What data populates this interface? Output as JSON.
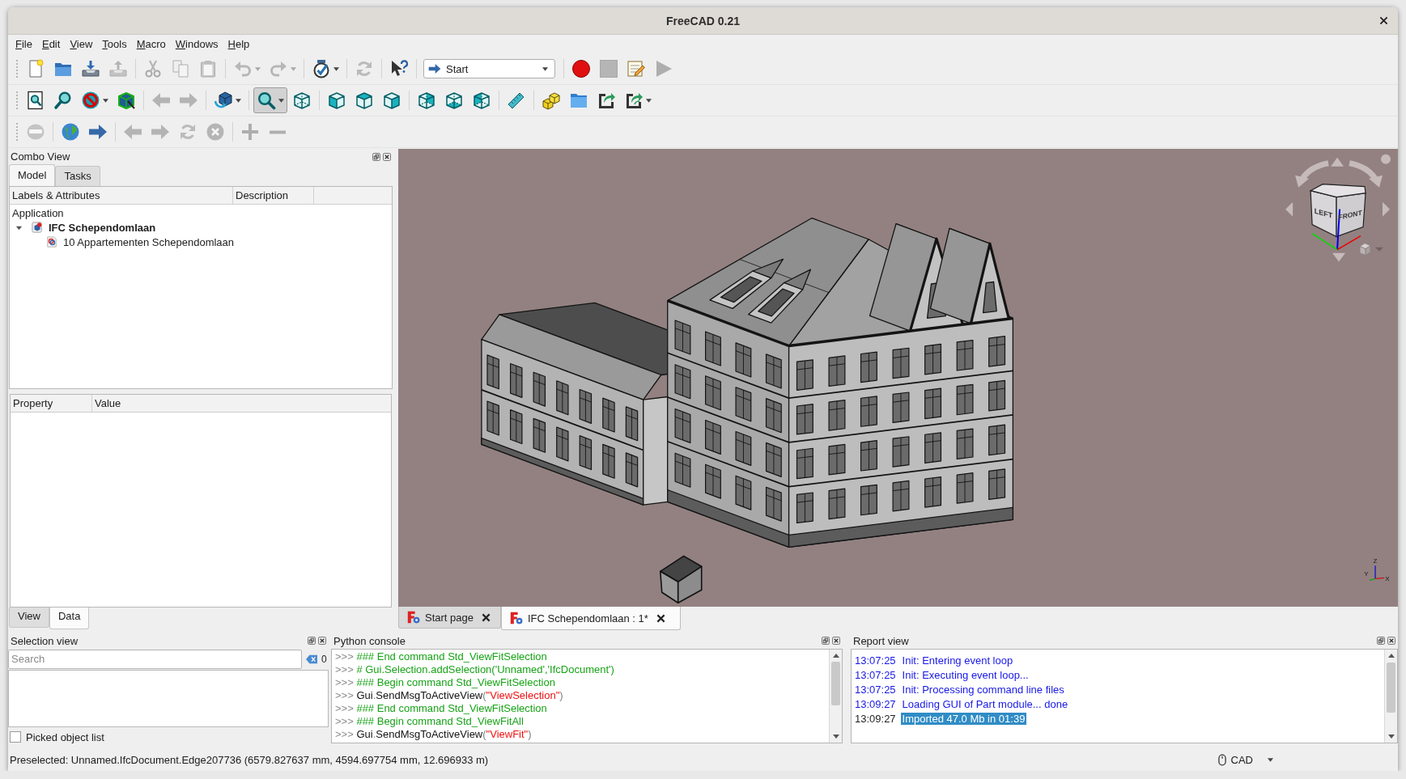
{
  "window": {
    "title": "FreeCAD 0.21"
  },
  "menu": [
    "File",
    "Edit",
    "View",
    "Tools",
    "Macro",
    "Windows",
    "Help"
  ],
  "toolbars": [
    {
      "groups": [
        [
          {
            "kind": "button",
            "disabled": false,
            "pressed": false,
            "menu": false
          },
          {
            "kind": "button",
            "disabled": false,
            "pressed": false,
            "menu": false
          },
          {
            "kind": "button",
            "disabled": false,
            "pressed": false,
            "menu": false
          },
          {
            "kind": "button",
            "disabled": true,
            "pressed": false,
            "menu": false
          }
        ],
        [
          {
            "kind": "button",
            "disabled": true,
            "pressed": false,
            "menu": false
          },
          {
            "kind": "button",
            "disabled": true,
            "pressed": false,
            "menu": false
          },
          {
            "kind": "button",
            "disabled": true,
            "pressed": false,
            "menu": false
          }
        ],
        [
          {
            "kind": "button",
            "disabled": true,
            "pressed": false,
            "menu": true
          },
          {
            "kind": "button",
            "disabled": true,
            "pressed": false,
            "menu": true
          }
        ],
        [
          {
            "kind": "button",
            "disabled": false,
            "pressed": false,
            "menu": true
          }
        ],
        [
          {
            "kind": "button",
            "disabled": true,
            "pressed": false,
            "menu": false
          }
        ],
        [
          {
            "kind": "button",
            "disabled": false,
            "pressed": false,
            "menu": false
          }
        ],
        [
          {
            "kind": "combo",
            "value": "Start"
          }
        ],
        [
          {
            "kind": "button",
            "disabled": false,
            "pressed": false,
            "menu": false
          },
          {
            "kind": "button",
            "disabled": true,
            "pressed": false,
            "menu": false
          },
          {
            "kind": "button",
            "disabled": false,
            "pressed": false,
            "menu": false
          },
          {
            "kind": "button",
            "disabled": true,
            "pressed": false,
            "menu": false
          }
        ]
      ]
    },
    {
      "groups": [
        [
          {
            "kind": "button",
            "disabled": false,
            "pressed": false,
            "menu": false
          },
          {
            "kind": "button",
            "disabled": false,
            "pressed": false,
            "menu": false
          },
          {
            "kind": "button",
            "disabled": false,
            "pressed": false,
            "menu": true
          },
          {
            "kind": "button",
            "disabled": false,
            "pressed": false,
            "menu": false
          }
        ],
        [
          {
            "kind": "button",
            "disabled": true,
            "pressed": false,
            "menu": false
          },
          {
            "kind": "button",
            "disabled": true,
            "pressed": false,
            "menu": false
          }
        ],
        [
          {
            "kind": "button",
            "disabled": false,
            "pressed": false,
            "menu": true
          }
        ],
        [
          {
            "kind": "button",
            "disabled": false,
            "pressed": true,
            "menu": true
          },
          {
            "kind": "button",
            "disabled": false,
            "pressed": false,
            "menu": false
          }
        ],
        [
          {
            "kind": "button",
            "disabled": false,
            "pressed": false,
            "menu": false
          },
          {
            "kind": "button",
            "disabled": false,
            "pressed": false,
            "menu": false
          },
          {
            "kind": "button",
            "disabled": false,
            "pressed": false,
            "menu": false
          }
        ],
        [
          {
            "kind": "button",
            "disabled": false,
            "pressed": false,
            "menu": false
          },
          {
            "kind": "button",
            "disabled": false,
            "pressed": false,
            "menu": false
          },
          {
            "kind": "button",
            "disabled": false,
            "pressed": false,
            "menu": false
          }
        ],
        [
          {
            "kind": "button",
            "disabled": false,
            "pressed": false,
            "menu": false
          }
        ],
        [
          {
            "kind": "button",
            "disabled": false,
            "pressed": false,
            "menu": false
          },
          {
            "kind": "button",
            "disabled": false,
            "pressed": false,
            "menu": false
          },
          {
            "kind": "button",
            "disabled": false,
            "pressed": false,
            "menu": false
          },
          {
            "kind": "button",
            "disabled": false,
            "pressed": false,
            "menu": true
          }
        ]
      ]
    },
    {
      "groups": [
        [
          {
            "kind": "button",
            "disabled": true,
            "pressed": false,
            "menu": false
          }
        ],
        [
          {
            "kind": "button",
            "disabled": false,
            "pressed": false,
            "menu": false
          },
          {
            "kind": "button",
            "disabled": false,
            "pressed": false,
            "menu": false
          }
        ],
        [
          {
            "kind": "button",
            "disabled": true,
            "pressed": false,
            "menu": false
          },
          {
            "kind": "button",
            "disabled": true,
            "pressed": false,
            "menu": false
          },
          {
            "kind": "button",
            "disabled": true,
            "pressed": false,
            "menu": false
          },
          {
            "kind": "button",
            "disabled": true,
            "pressed": false,
            "menu": false
          }
        ],
        [
          {
            "kind": "button",
            "disabled": true,
            "pressed": false,
            "menu": false
          },
          {
            "kind": "button",
            "disabled": true,
            "pressed": false,
            "menu": false
          }
        ]
      ]
    }
  ],
  "combo_view": {
    "title": "Combo View",
    "tabs": [
      {
        "label": "Model",
        "selected": true
      },
      {
        "label": "Tasks",
        "selected": false
      }
    ],
    "tree": {
      "columns": [
        "Labels & Attributes",
        "Description"
      ],
      "root": "Application",
      "documents": [
        {
          "label": "IFC Schependomlaan",
          "active": true,
          "expanded": true,
          "children": [
            {
              "label": "10 Appartementen Schependomlaan"
            }
          ]
        }
      ]
    },
    "property_view": {
      "columns": [
        "Property",
        "Value"
      ],
      "tabs": [
        {
          "label": "View",
          "selected": false
        },
        {
          "label": "Data",
          "selected": true
        }
      ]
    }
  },
  "viewport": {
    "nav_cube": {
      "faces": [
        "LEFT",
        "FRONT"
      ]
    },
    "axis_labels": [
      "Z",
      "Y",
      "X"
    ],
    "tabs": [
      {
        "label": "Start page",
        "selected": false
      },
      {
        "label": "IFC Schependomlaan : 1*",
        "selected": true
      }
    ]
  },
  "selection_view": {
    "title": "Selection view",
    "search": {
      "placeholder": "Search"
    },
    "count": "0",
    "picked_list": {
      "label": "Picked object list",
      "checked": false
    }
  },
  "python_console": {
    "title": "Python console",
    "lines": [
      {
        "prompt": ">>>",
        "segments": [
          {
            "kind": "comment",
            "text": "### End command Std_ViewFitSelection"
          }
        ]
      },
      {
        "prompt": ">>>",
        "segments": [
          {
            "kind": "comment",
            "text": "# Gui.Selection.addSelection('Unnamed','IfcDocument')"
          }
        ]
      },
      {
        "prompt": ">>>",
        "segments": [
          {
            "kind": "comment",
            "text": "### Begin command Std_ViewFitSelection"
          }
        ]
      },
      {
        "prompt": ">>>",
        "segments": [
          {
            "kind": "code",
            "text": "Gui"
          },
          {
            "kind": "punct",
            "text": "."
          },
          {
            "kind": "code",
            "text": "SendMsgToActiveView"
          },
          {
            "kind": "punct",
            "text": "("
          },
          {
            "kind": "string",
            "text": "\"ViewSelection\""
          },
          {
            "kind": "punct",
            "text": ")"
          }
        ]
      },
      {
        "prompt": ">>>",
        "segments": [
          {
            "kind": "comment",
            "text": "### End command Std_ViewFitSelection"
          }
        ]
      },
      {
        "prompt": ">>>",
        "segments": [
          {
            "kind": "comment",
            "text": "### Begin command Std_ViewFitAll"
          }
        ]
      },
      {
        "prompt": ">>>",
        "segments": [
          {
            "kind": "code",
            "text": "Gui"
          },
          {
            "kind": "punct",
            "text": "."
          },
          {
            "kind": "code",
            "text": "SendMsgToActiveView"
          },
          {
            "kind": "punct",
            "text": "("
          },
          {
            "kind": "string",
            "text": "\"ViewFit\""
          },
          {
            "kind": "punct",
            "text": ")"
          }
        ]
      }
    ]
  },
  "report_view": {
    "title": "Report view",
    "lines": [
      {
        "time": "13:07:25",
        "text": "Init: Entering event loop",
        "kind": "log",
        "selected": false
      },
      {
        "time": "13:07:25",
        "text": "Init: Executing event loop...",
        "kind": "log",
        "selected": false
      },
      {
        "time": "13:07:25",
        "text": "Init: Processing command line files",
        "kind": "log",
        "selected": false
      },
      {
        "time": "13:09:27",
        "text": "Loading GUI of Part module... done",
        "kind": "log",
        "selected": false
      },
      {
        "time": "13:09:27",
        "text": "Imported 47.0 Mb in 01:39",
        "kind": "message",
        "selected": true
      }
    ]
  },
  "status_bar": {
    "text": "Preselected: Unnamed.IfcDocument.Edge207736 (6579.827637 mm, 4594.697754 mm, 12.696933 m)",
    "navigation": "CAD"
  }
}
